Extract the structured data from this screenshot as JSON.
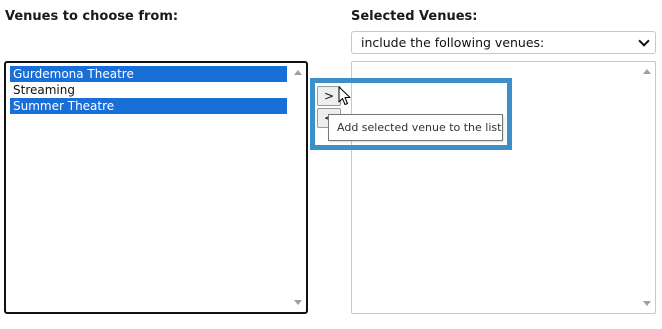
{
  "left_panel": {
    "heading": "Venues to choose from:",
    "options": [
      {
        "label": "Gurdemona Theatre",
        "selected": true
      },
      {
        "label": "Streaming",
        "selected": false
      },
      {
        "label": "Summer Theatre",
        "selected": true
      }
    ]
  },
  "right_panel": {
    "heading": "Selected Venues:",
    "mode_select": {
      "value": "include the following venues:"
    },
    "options": []
  },
  "buttons": {
    "add_label": ">",
    "remove_label": "<"
  },
  "tooltip": {
    "text": "Add selected venue to the list"
  },
  "colors": {
    "selection": "#1a6fd6",
    "highlight_box": "#3d8fc8"
  },
  "icons": {
    "scroll_up": "scroll-up-arrow-icon",
    "scroll_down": "scroll-down-arrow-icon",
    "cursor": "mouse-pointer-icon",
    "dropdown": "chevron-down-icon"
  }
}
